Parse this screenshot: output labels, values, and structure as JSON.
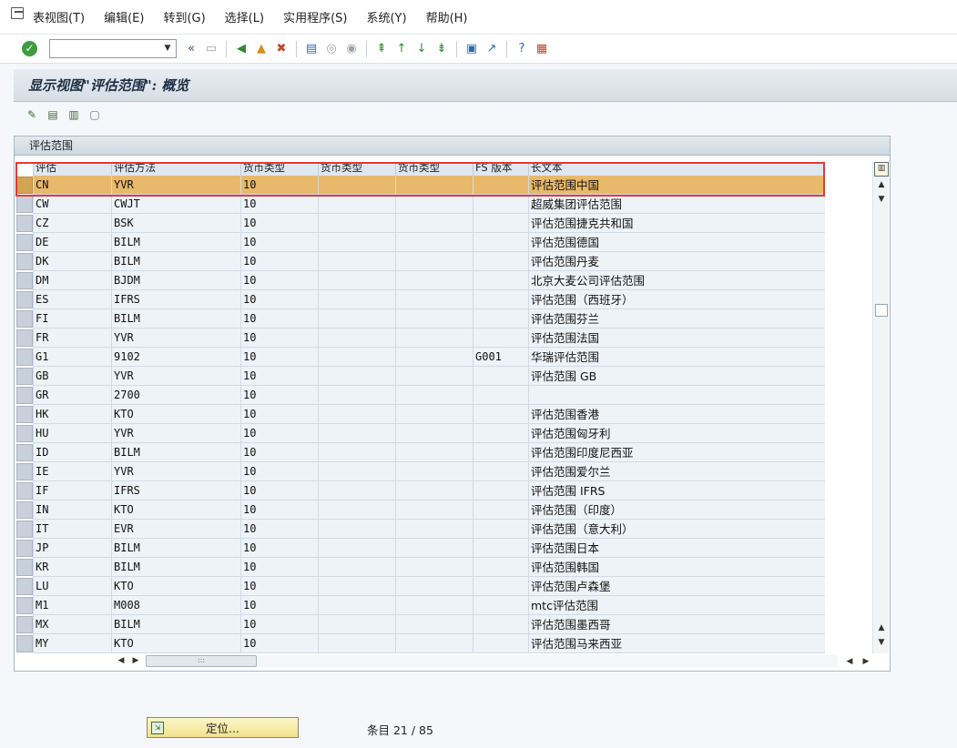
{
  "menu": [
    {
      "label": "表视图(T)"
    },
    {
      "label": "编辑(E)"
    },
    {
      "label": "转到(G)"
    },
    {
      "label": "选择(L)"
    },
    {
      "label": "实用程序(S)"
    },
    {
      "label": "系统(Y)"
    },
    {
      "label": "帮助(H)"
    }
  ],
  "toolbar": {
    "command_value": "",
    "icons": [
      "ok-icon",
      "dropdown-icon",
      "back-double-icon",
      "save-icon",
      "back-icon",
      "exit-icon",
      "cancel-icon",
      "print-icon",
      "find-icon",
      "find-next-icon",
      "first-page-icon",
      "prev-page-icon",
      "next-page-icon",
      "last-page-icon",
      "new-session-icon",
      "shortcut-icon",
      "help-icon",
      "layout-icon"
    ]
  },
  "title": "显示视图\"评估范围\": 概览",
  "app_toolbar": {
    "icons": [
      "change-display-icon",
      "select-all-icon",
      "select-block-icon",
      "deselect-all-icon"
    ]
  },
  "table": {
    "title": "评估范围",
    "columns": [
      "评估",
      "评估方法",
      "货币类型",
      "货币类型",
      "货币类型",
      "FS 版本",
      "长文本"
    ],
    "rows": [
      [
        "CN",
        "YVR",
        "10",
        "",
        "",
        "",
        "评估范围中国"
      ],
      [
        "CW",
        "CWJT",
        "10",
        "",
        "",
        "",
        "超威集团评估范围"
      ],
      [
        "CZ",
        "BSK",
        "10",
        "",
        "",
        "",
        "评估范围捷克共和国"
      ],
      [
        "DE",
        "BILM",
        "10",
        "",
        "",
        "",
        "评估范围德国"
      ],
      [
        "DK",
        "BILM",
        "10",
        "",
        "",
        "",
        "评估范围丹麦"
      ],
      [
        "DM",
        "BJDM",
        "10",
        "",
        "",
        "",
        "北京大麦公司评估范围"
      ],
      [
        "ES",
        "IFRS",
        "10",
        "",
        "",
        "",
        "评估范围（西班牙）"
      ],
      [
        "FI",
        "BILM",
        "10",
        "",
        "",
        "",
        "评估范围芬兰"
      ],
      [
        "FR",
        "YVR",
        "10",
        "",
        "",
        "",
        "评估范围法国"
      ],
      [
        "G1",
        "9102",
        "10",
        "",
        "",
        "G001",
        "华瑞评估范围"
      ],
      [
        "GB",
        "YVR",
        "10",
        "",
        "",
        "",
        "评估范围 GB"
      ],
      [
        "GR",
        "2700",
        "10",
        "",
        "",
        "",
        ""
      ],
      [
        "HK",
        "KTO",
        "10",
        "",
        "",
        "",
        "评估范围香港"
      ],
      [
        "HU",
        "YVR",
        "10",
        "",
        "",
        "",
        "评估范围匈牙利"
      ],
      [
        "ID",
        "BILM",
        "10",
        "",
        "",
        "",
        "评估范围印度尼西亚"
      ],
      [
        "IE",
        "YVR",
        "10",
        "",
        "",
        "",
        "评估范围爱尔兰"
      ],
      [
        "IF",
        "IFRS",
        "10",
        "",
        "",
        "",
        "评估范围 IFRS"
      ],
      [
        "IN",
        "KTO",
        "10",
        "",
        "",
        "",
        "评估范围（印度）"
      ],
      [
        "IT",
        "EVR",
        "10",
        "",
        "",
        "",
        "评估范围（意大利）"
      ],
      [
        "JP",
        "BILM",
        "10",
        "",
        "",
        "",
        "评估范围日本"
      ],
      [
        "KR",
        "BILM",
        "10",
        "",
        "",
        "",
        "评估范围韩国"
      ],
      [
        "LU",
        "KTO",
        "10",
        "",
        "",
        "",
        "评估范围卢森堡"
      ],
      [
        "M1",
        "M008",
        "10",
        "",
        "",
        "",
        "mtc评估范围"
      ],
      [
        "MX",
        "BILM",
        "10",
        "",
        "",
        "",
        "评估范围墨西哥"
      ],
      [
        "MY",
        "KTO",
        "10",
        "",
        "",
        "",
        "评估范围马来西亚"
      ]
    ],
    "highlighted_row": 0,
    "highlight_color": "#e8b96a"
  },
  "footer": {
    "locate_label": "定位...",
    "entry_text": "条目 21 / 85"
  }
}
